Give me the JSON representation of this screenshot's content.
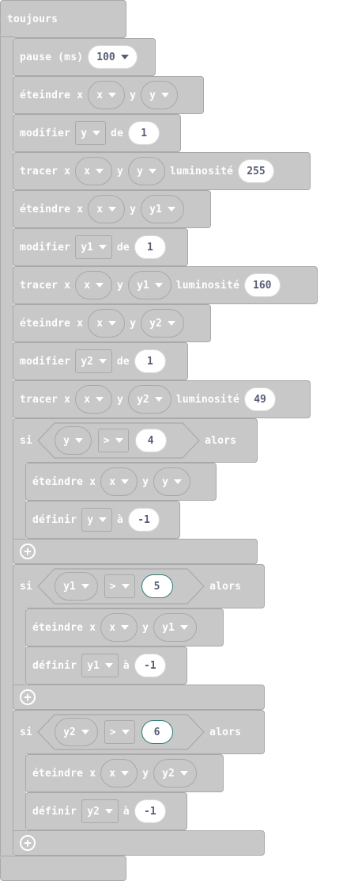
{
  "kw": {
    "toujours": "toujours",
    "pause": "pause (ms)",
    "eteindre": "éteindre x",
    "modifier": "modifier",
    "de": "de",
    "tracer": "tracer x",
    "y": "y",
    "luminosite": "luminosité",
    "si": "si",
    "alors": "alors",
    "definir": "définir",
    "a": "à"
  },
  "vars": {
    "x": "x",
    "y": "y",
    "y1": "y1",
    "y2": "y2"
  },
  "op": ">",
  "values": {
    "pause": "100",
    "change_y": "1",
    "bright_y": "255",
    "change_y1": "1",
    "bright_y1": "160",
    "change_y2": "1",
    "bright_y2": "49",
    "cond1": "4",
    "set1": "-1",
    "cond2": "5",
    "set2": "-1",
    "cond3": "6",
    "set3": "-1"
  },
  "colors": {
    "block": "#c8c8c8",
    "border": "#a9a9a9",
    "text_dark": "#575e75",
    "focus_teal": "#2e7d7a"
  },
  "icons": {
    "add": "plus-circle-icon",
    "dropdown": "caret-down-icon"
  }
}
